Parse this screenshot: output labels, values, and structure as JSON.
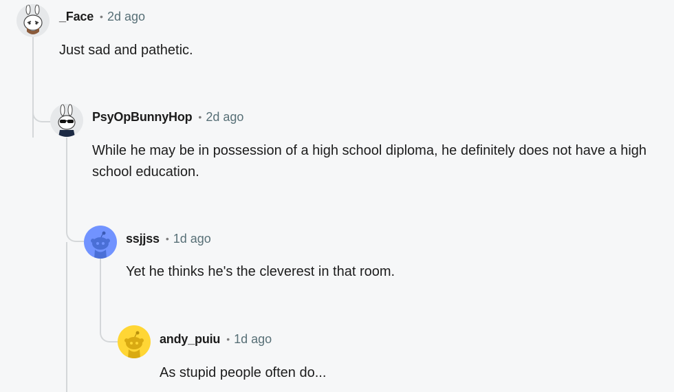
{
  "comments": [
    {
      "username": "_Face",
      "separator": "•",
      "time": "2d ago",
      "text": "Just sad and pathetic.",
      "avatar": "snoo-avatar-face"
    },
    {
      "username": "PsyOpBunnyHop",
      "separator": "•",
      "time": "2d ago",
      "text": "While he may be in possession of a high school diploma, he definitely does not have a high school education.",
      "avatar": "snoo-avatar-bunny-sunglasses"
    },
    {
      "username": "ssjjss",
      "separator": "•",
      "time": "1d ago",
      "text": "Yet he thinks he's the cleverest in that room.",
      "avatar": "default-snoo-avatar-blue"
    },
    {
      "username": "andy_puiu",
      "separator": "•",
      "time": "1d ago",
      "text": "As stupid people often do...",
      "avatar": "default-snoo-avatar-yellow"
    }
  ],
  "colors": {
    "background": "#f6f7f8",
    "thread_line": "#d4d7d9",
    "username": "#1c1c1c",
    "timestamp": "#576f76",
    "avatar_blue": "#7193ff",
    "avatar_yellow": "#ffd635"
  }
}
